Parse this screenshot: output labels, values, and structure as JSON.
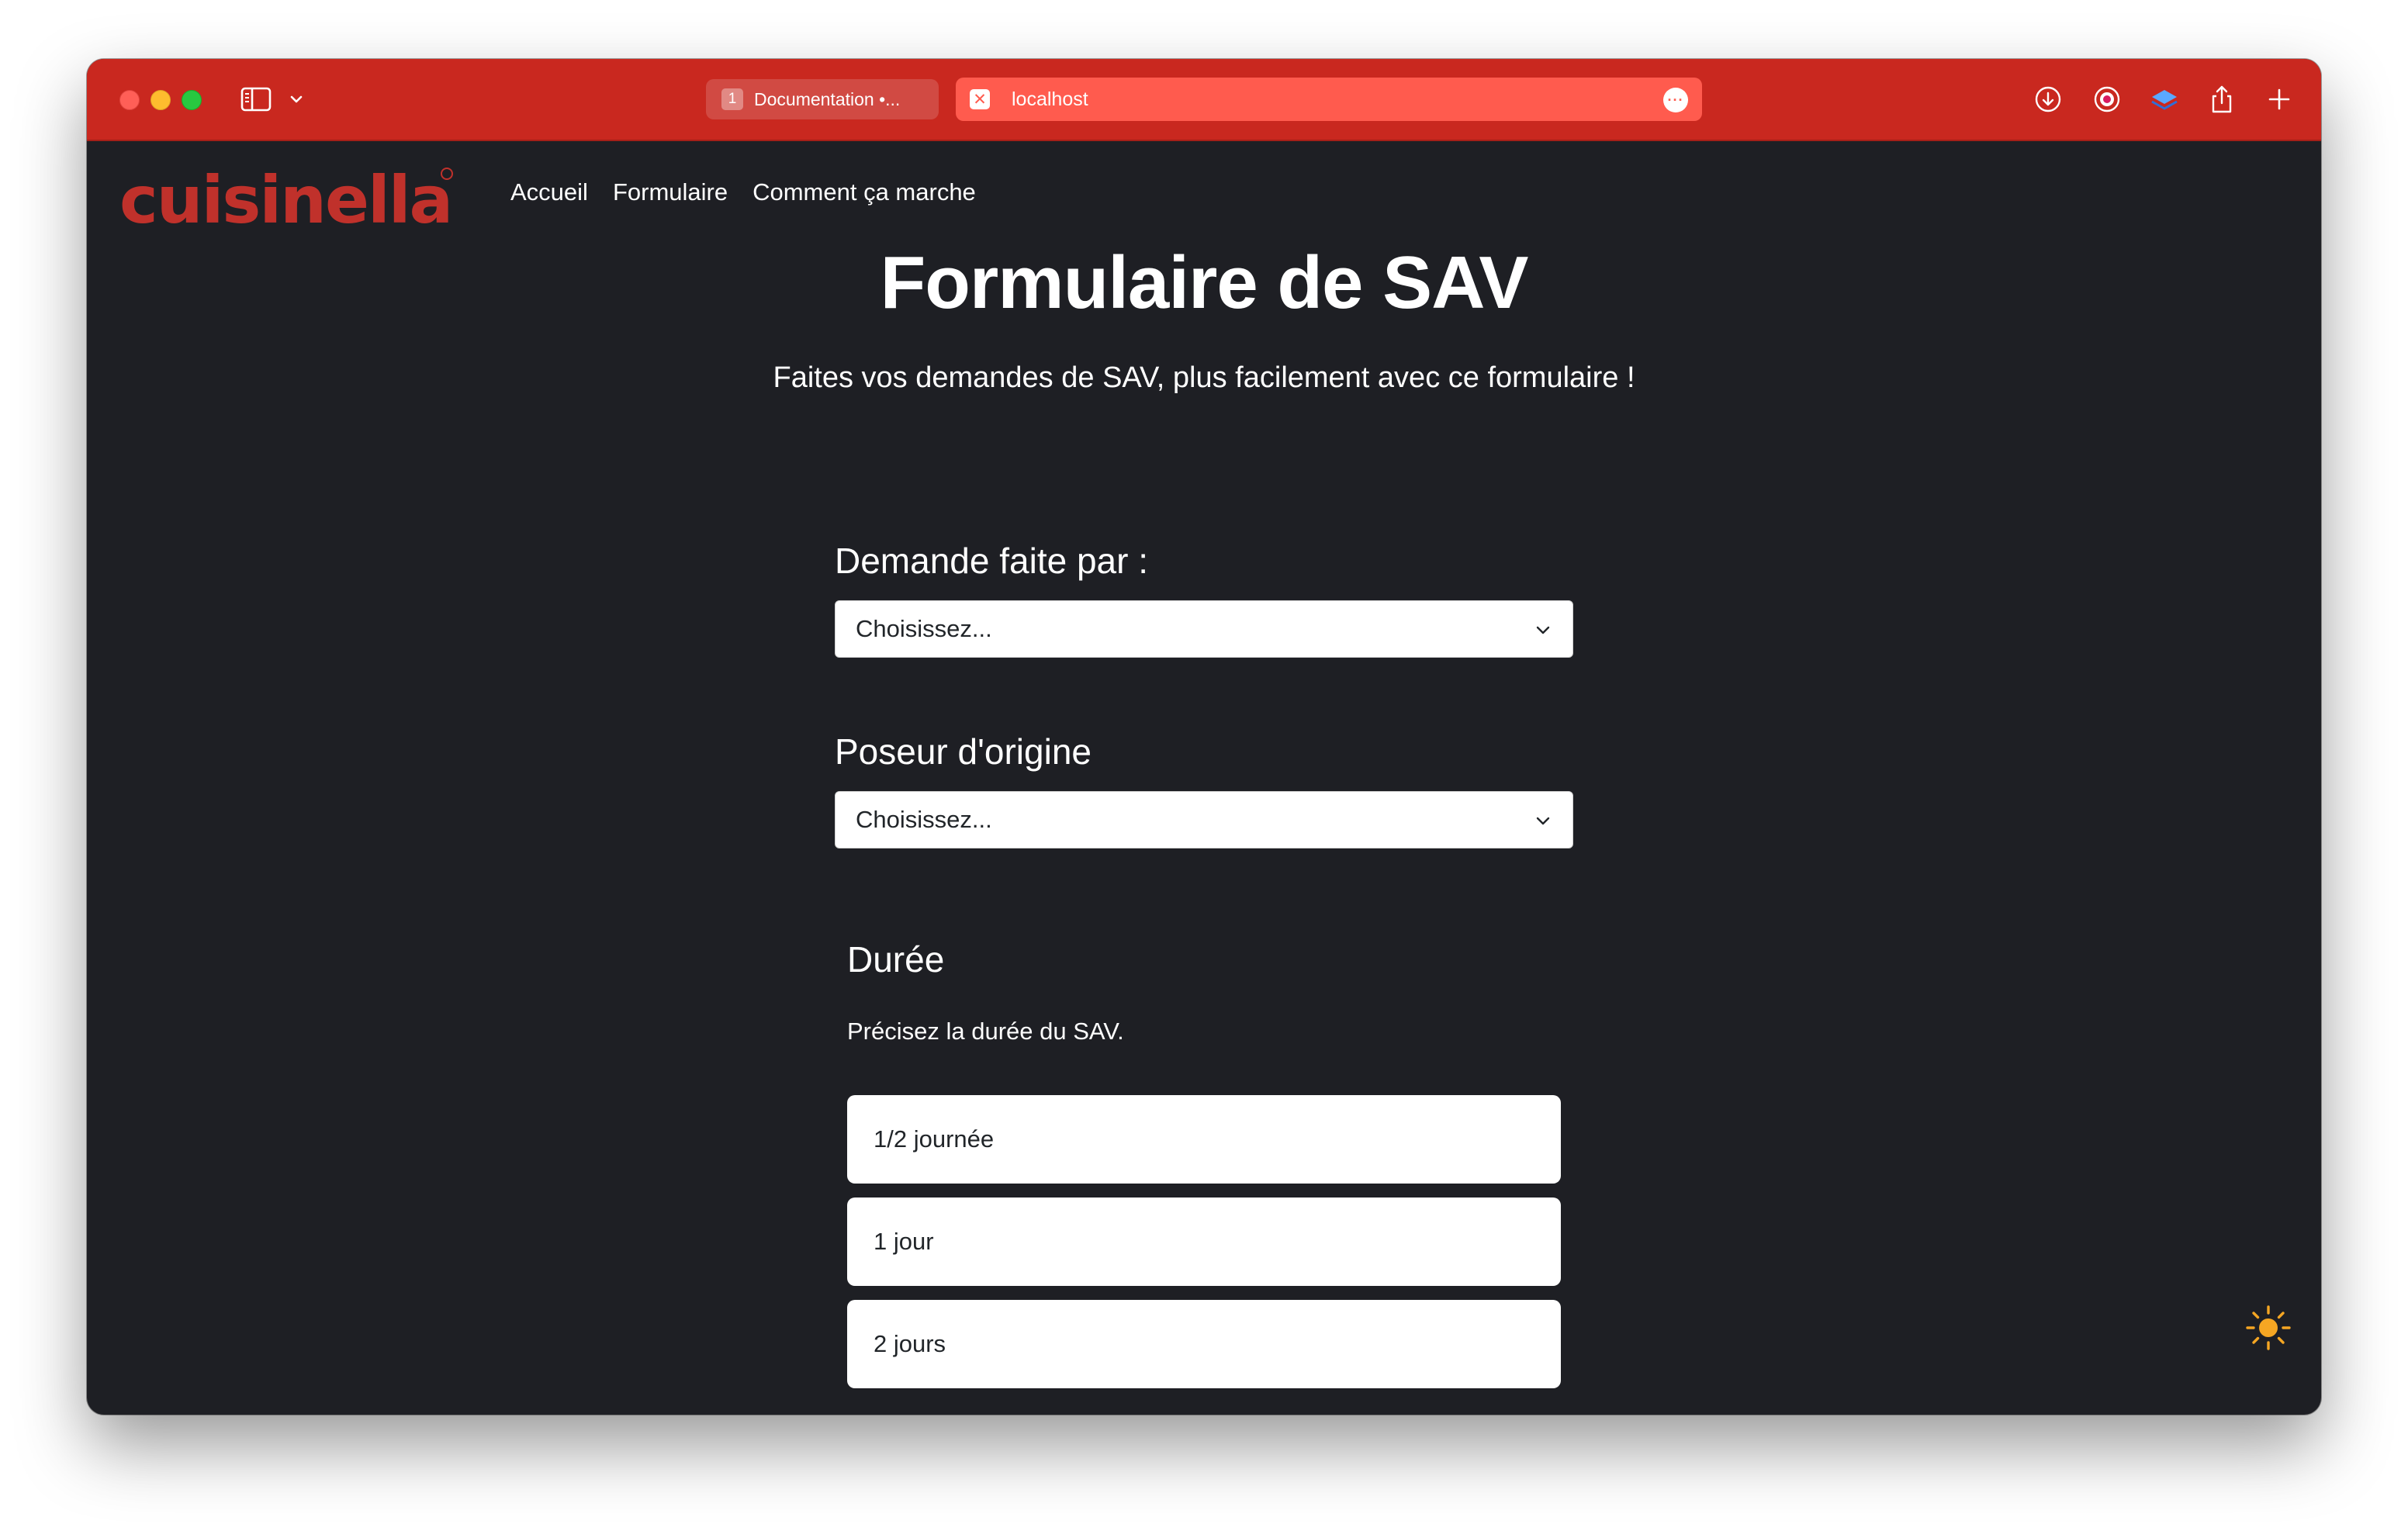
{
  "browser": {
    "tabs": [
      {
        "badge": "1",
        "title": "Documentation •...",
        "active": false
      },
      {
        "badge": "x",
        "title": "localhost",
        "active": true
      }
    ],
    "address_more": "•••",
    "accent_color": "#c9281f"
  },
  "site": {
    "logo": "cuisinella",
    "nav": [
      "Accueil",
      "Formulaire",
      "Comment ça marche"
    ]
  },
  "page": {
    "title": "Formulaire de SAV",
    "subtitle": "Faites vos demandes de SAV, plus facilement avec ce formulaire !"
  },
  "form": {
    "requested_by": {
      "label": "Demande faite par :",
      "value": "Choisissez..."
    },
    "original_installer": {
      "label": "Poseur d'origine",
      "value": "Choisissez..."
    },
    "duration": {
      "title": "Durée",
      "description": "Précisez la durée du SAV.",
      "options": [
        "1/2 journée",
        "1 jour",
        "2 jours"
      ]
    }
  },
  "theme_toggle": {
    "icon": "sun-icon",
    "color": "#f5a623"
  }
}
